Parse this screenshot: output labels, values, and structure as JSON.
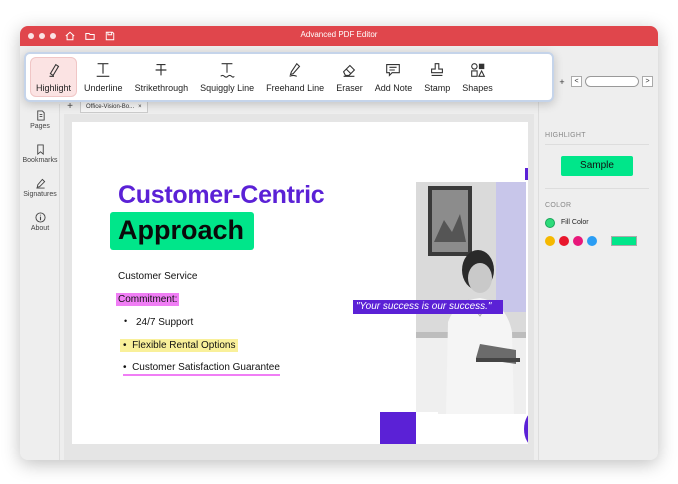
{
  "window": {
    "title": "Advanced PDF Editor",
    "traffic_colors": [
      "#ffffff",
      "#ffffff",
      "#ffffff"
    ]
  },
  "toolbar": {
    "tools": [
      {
        "label": "Highlight",
        "icon": "highlighter-icon",
        "active": true
      },
      {
        "label": "Underline",
        "icon": "underline-icon"
      },
      {
        "label": "Strikethrough",
        "icon": "strikethrough-icon"
      },
      {
        "label": "Squiggly Line",
        "icon": "squiggly-icon"
      },
      {
        "label": "Freehand Line",
        "icon": "pen-icon"
      },
      {
        "label": "Eraser",
        "icon": "eraser-icon"
      },
      {
        "label": "Add Note",
        "icon": "note-icon"
      },
      {
        "label": "Stamp",
        "icon": "stamp-icon"
      },
      {
        "label": "Shapes",
        "icon": "shapes-icon"
      }
    ]
  },
  "nav": {
    "prev": "<",
    "next": ">",
    "plus": "+"
  },
  "sidebar": {
    "items": [
      {
        "label": "Pages",
        "icon": "pages-icon"
      },
      {
        "label": "Bookmarks",
        "icon": "bookmark-icon"
      },
      {
        "label": "Signatures",
        "icon": "signature-icon"
      },
      {
        "label": "About",
        "icon": "info-icon"
      }
    ]
  },
  "tabs": {
    "add": "+",
    "doc_tab": "Office-Vision-Bo...",
    "close": "×"
  },
  "document": {
    "heading1": "Customer-Centric",
    "heading2": "Approach",
    "line_service": "Customer Service",
    "line_commitment": "Commitment:",
    "bullets": [
      "24/7 Support",
      "Flexible Rental Options",
      "Customer Satisfaction Guarantee"
    ],
    "quote": "\"Your success is our success.\""
  },
  "right_panel": {
    "highlight_section": "HIGHLIGHT",
    "sample_label": "Sample",
    "color_section": "COLOR",
    "fill_color_label": "Fill Color",
    "swatches": [
      "#f5b800",
      "#e8172c",
      "#e8177a",
      "#2a9df4"
    ],
    "selected_color": "#00e68a"
  },
  "colors": {
    "accent_red": "#e0464c",
    "brand_purple": "#5b21d6",
    "highlight_green": "#00e68a",
    "highlight_pink": "#f07ef5",
    "highlight_yellow": "#f9f09a"
  }
}
